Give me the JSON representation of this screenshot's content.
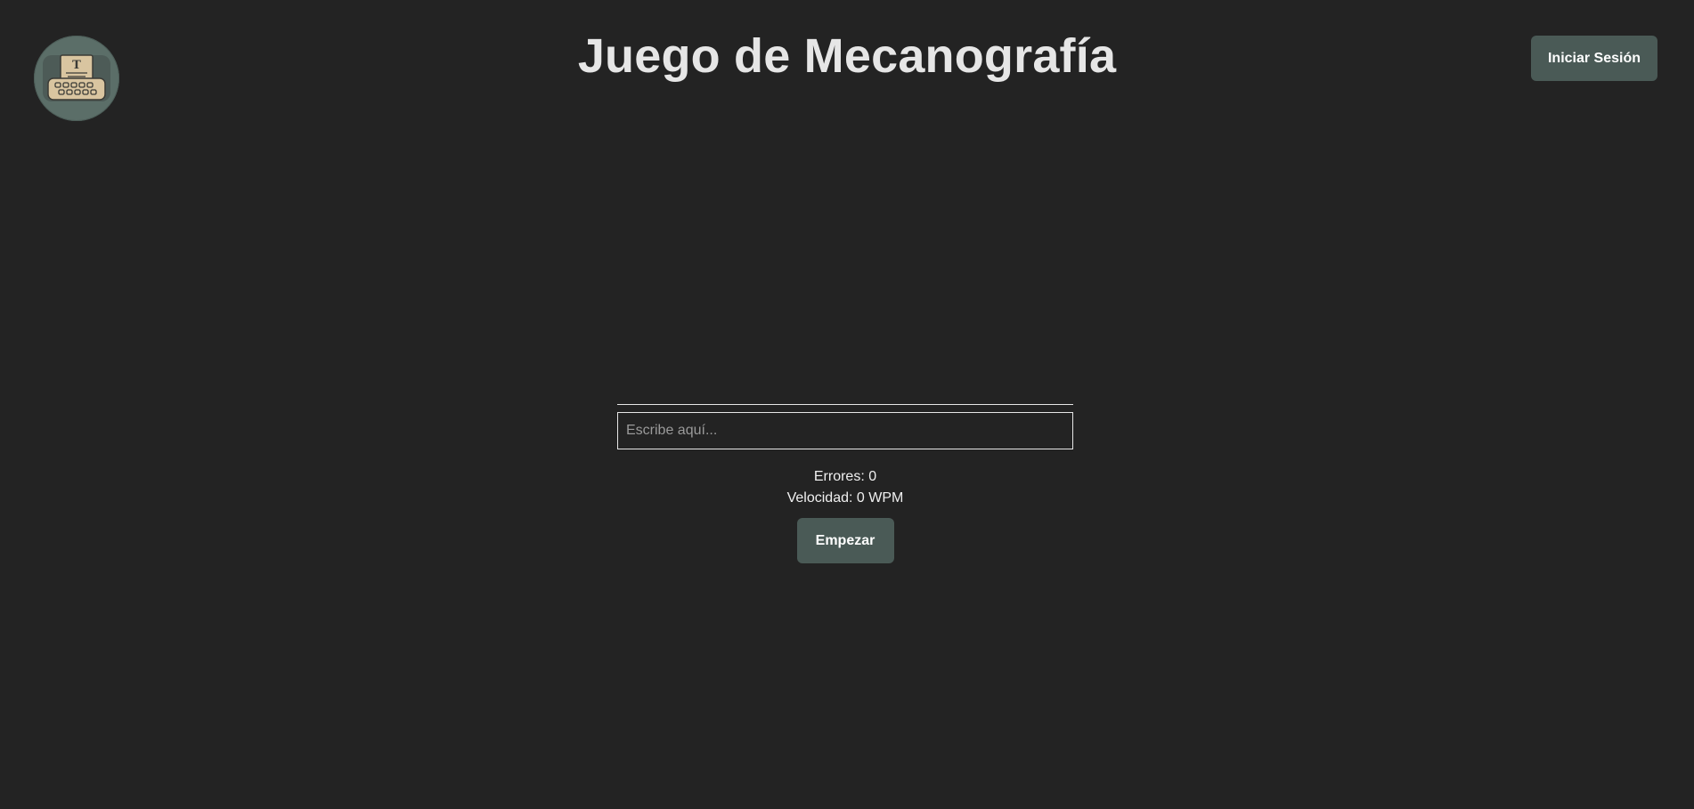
{
  "header": {
    "logo_icon": "typewriter-icon",
    "title": "Juego de Mecanografía",
    "login_label": "Iniciar Sesión"
  },
  "game": {
    "text_to_type": "",
    "input_value": "",
    "input_placeholder": "Escribe aquí...",
    "errors_label": "Errores:",
    "errors_value": "0",
    "speed_label": "Velocidad:",
    "speed_value": "0",
    "speed_unit": "WPM",
    "start_label": "Empezar"
  },
  "colors": {
    "background": "#232323",
    "button": "#4a5a56",
    "logo_circle": "#5b6e68",
    "typewriter_body": "#d9c5a0",
    "text": "#e6e6e6"
  }
}
